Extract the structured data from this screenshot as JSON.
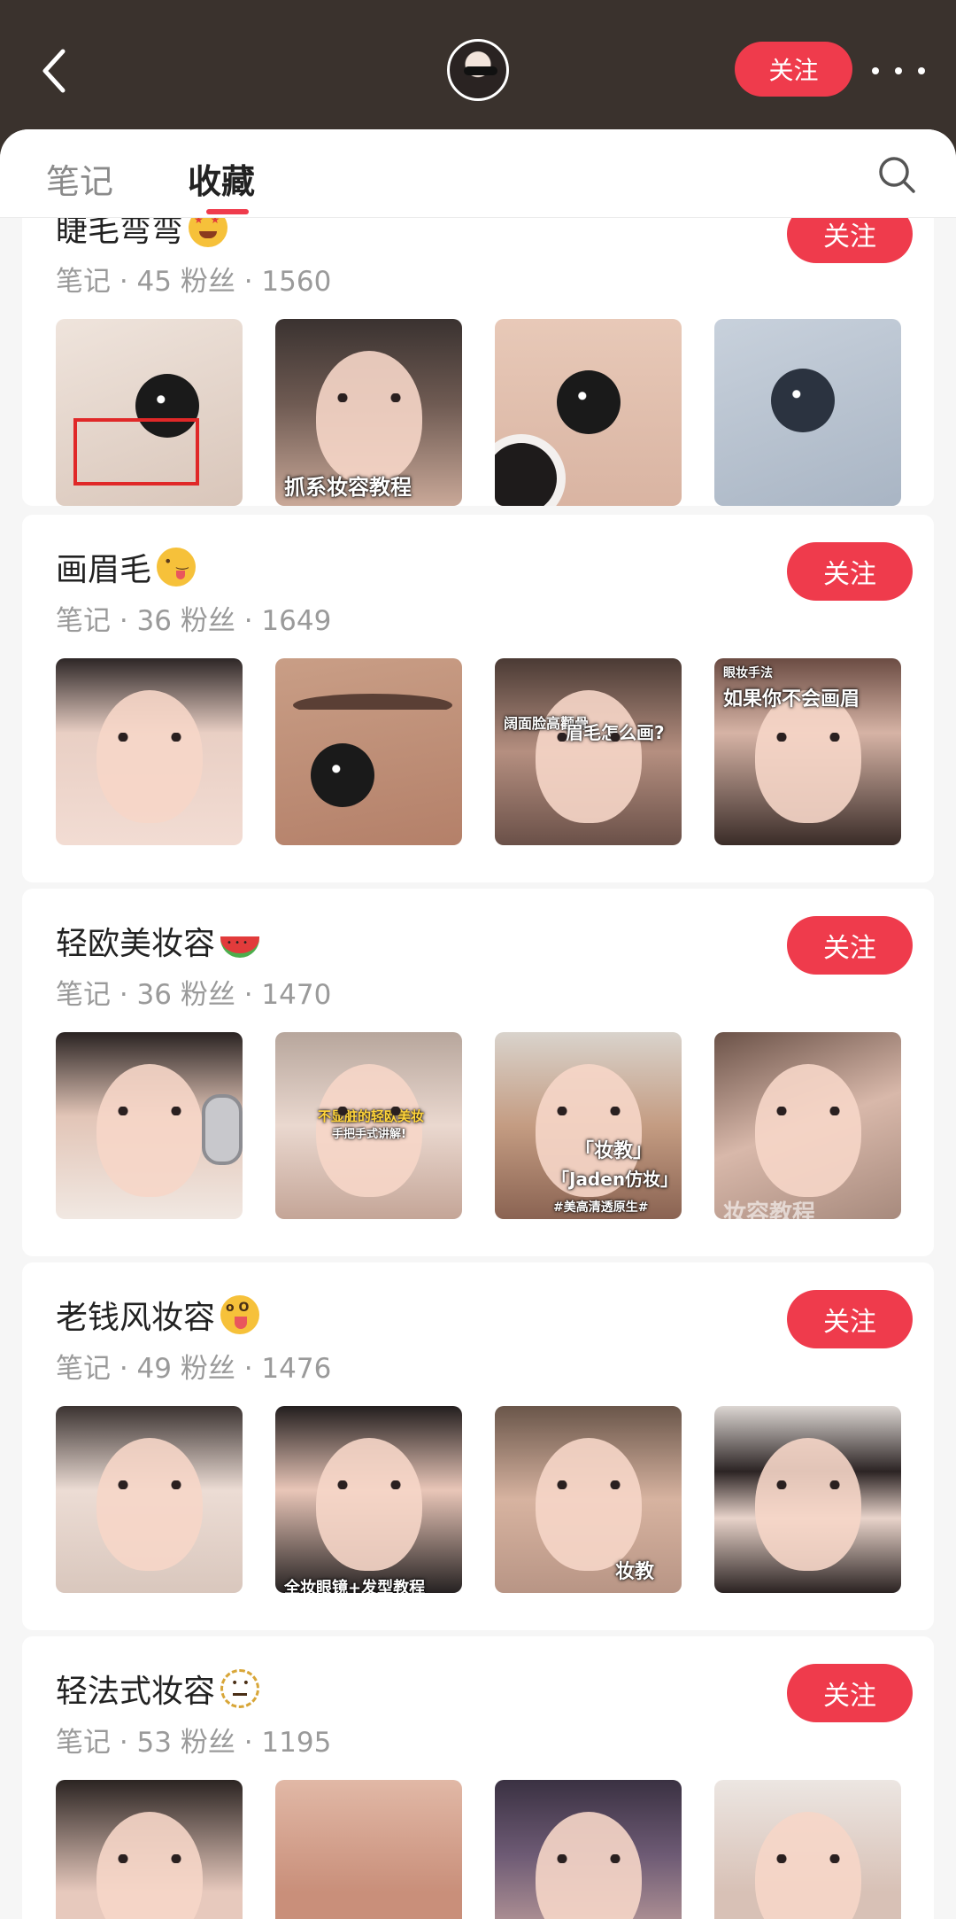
{
  "header": {
    "back_icon": "chevron-left-icon",
    "follow_label": "关注",
    "more_icon": "more-dots-icon"
  },
  "tabs": [
    {
      "label": "笔记",
      "active": false
    },
    {
      "label": "收藏",
      "active": true
    }
  ],
  "search_icon": "search-icon",
  "boards": [
    {
      "title": "睫毛弯弯",
      "emoji": "star-struck-emoji",
      "meta": "笔记 · 45   粉丝 · 1560",
      "follow_label": "关注",
      "thumbs": [
        {
          "caption": ""
        },
        {
          "caption": "抓系妆容教程"
        },
        {
          "caption": ""
        },
        {
          "caption": ""
        }
      ]
    },
    {
      "title": "画眉毛",
      "emoji": "winking-tongue-emoji",
      "meta": "笔记 · 36   粉丝 · 1649",
      "follow_label": "关注",
      "thumbs": [
        {
          "caption": ""
        },
        {
          "caption": ""
        },
        {
          "caption": "眉毛怎么画?",
          "caption_top": "阔面脸高颧骨"
        },
        {
          "caption": "如果你不会画眉",
          "caption_top": "眼妆手法"
        }
      ]
    },
    {
      "title": "轻欧美妆容",
      "emoji": "watermelon-emoji",
      "meta": "笔记 · 36   粉丝 · 1470",
      "follow_label": "关注",
      "thumbs": [
        {
          "caption": ""
        },
        {
          "caption": "不显脏的轻欧美妆",
          "caption_sub": "手把手式讲解!"
        },
        {
          "caption": "「Jaden仿妆」",
          "caption_top": "「妆教」",
          "caption_sub": "#美高清透原生#"
        },
        {
          "caption": "妆容教程"
        }
      ]
    },
    {
      "title": "老钱风妆容",
      "emoji": "zany-face-emoji",
      "meta": "笔记 · 49   粉丝 · 1476",
      "follow_label": "关注",
      "thumbs": [
        {
          "caption": ""
        },
        {
          "caption": "全妆眼镜+发型教程"
        },
        {
          "caption": "妆教"
        },
        {
          "caption": ""
        }
      ]
    },
    {
      "title": "轻法式妆容",
      "emoji": "dotted-line-face-emoji",
      "meta": "笔记 · 53   粉丝 · 1195",
      "follow_label": "关注",
      "thumbs": [
        {
          "caption": ""
        },
        {
          "caption": ""
        },
        {
          "caption": ""
        },
        {
          "caption": ""
        }
      ]
    }
  ]
}
